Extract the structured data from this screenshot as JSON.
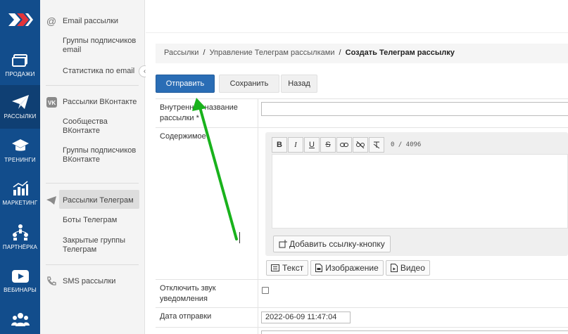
{
  "rail": {
    "items": [
      {
        "label": "Продажи",
        "icon": "card-icon"
      },
      {
        "label": "Рассылки",
        "icon": "paper-plane-icon"
      },
      {
        "label": "Тренинги",
        "icon": "graduation-cap-icon"
      },
      {
        "label": "Маркетинг",
        "icon": "bar-chart-icon"
      },
      {
        "label": "Партнёрка",
        "icon": "people-network-icon"
      },
      {
        "label": "Вебинары",
        "icon": "play-icon"
      }
    ]
  },
  "submenu": {
    "email_head": "Email рассылки",
    "email_groups": "Группы подписчиков email",
    "email_stats": "Статистика по email",
    "vk_head": "Рассылки ВКонтакте",
    "vk_communities": "Сообщества ВКонтакте",
    "vk_groups": "Группы подписчиков ВКонтакте",
    "tg_head": "Рассылки Телеграм",
    "tg_bots": "Боты Телеграм",
    "tg_closed": "Закрытые группы Телеграм",
    "sms_head": "SMS рассылки"
  },
  "breadcrumb": {
    "item1": "Рассылки",
    "item2": "Управление Телеграм рассылками",
    "current": "Создать Телеграм рассылку",
    "sep": "/"
  },
  "actions": {
    "send": "Отправить",
    "save": "Сохранить",
    "back": "Назад"
  },
  "form": {
    "internal_name_label": "Внутреннее название рассылки *",
    "internal_name_value": "",
    "content_label": "Содержимое",
    "counter": "0 / 4096",
    "add_link_button": "Добавить ссылку-кнопку",
    "type_text": "Текст",
    "type_image": "Изображение",
    "type_video": "Видео",
    "mute_label": "Отключить звук уведомления",
    "mute_checked": false,
    "date_label": "Дата отправки",
    "date_value": "2022-06-09 11:47:04"
  },
  "colors": {
    "rail": "#124d8c",
    "primary": "#2a6db5",
    "arrow": "#19b21c"
  }
}
